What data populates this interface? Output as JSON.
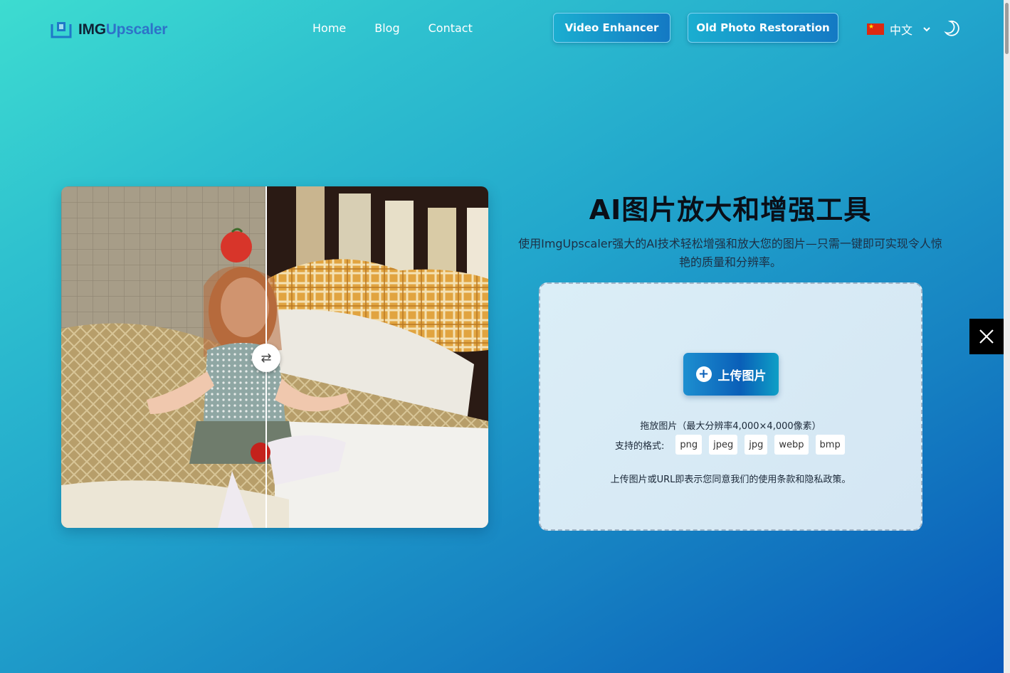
{
  "header": {
    "logo": {
      "part1": "IMG",
      "part2": "Upscaler"
    },
    "nav": [
      "Home",
      "Blog",
      "Contact"
    ],
    "buttons": {
      "video": "Video Enhancer",
      "old_photo": "Old Photo Restoration"
    },
    "language": "中文"
  },
  "hero": {
    "title": "AI图片放大和增强工具",
    "subtitle": "使用ImgUpscaler强大的AI技术轻松增强和放大您的图片—只需一键即可实现令人惊艳的质量和分辨率。"
  },
  "upload": {
    "button_label": "上传图片",
    "drop_hint": "拖放图片（最大分辨率4,000×4,000像素）",
    "formats_label": "支持的格式:",
    "formats": [
      "png",
      "jpeg",
      "jpg",
      "webp",
      "bmp"
    ],
    "terms": "上传图片或URL即表示您同意我们的使用条款和隐私政策。"
  },
  "compare": {
    "handle_glyph": "⇄"
  },
  "icons": {
    "logo": "logo-icon",
    "flag": "china-flag-icon",
    "chevron": "chevron-down-icon",
    "theme": "moon-icon",
    "plus": "plus-icon",
    "share": "x-logo-icon",
    "swap": "swap-arrows-icon"
  }
}
